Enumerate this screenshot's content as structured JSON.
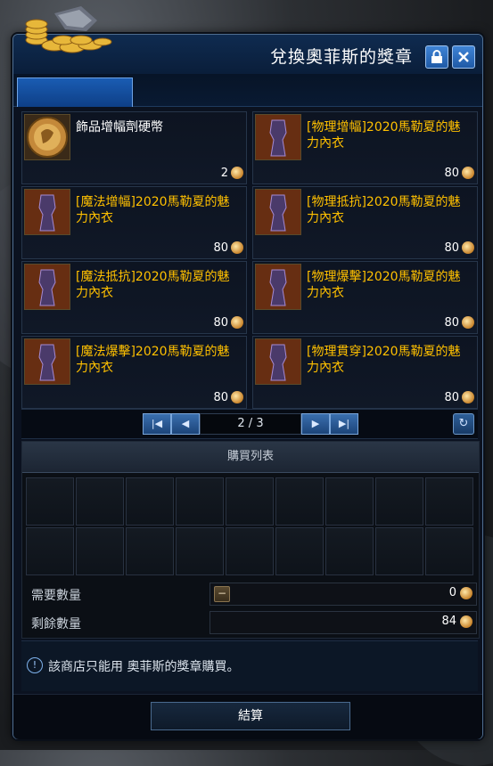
{
  "window": {
    "title": "兌換奧菲斯的獎章",
    "lock_icon": "lock-icon",
    "close_icon": "close-icon"
  },
  "tabs": [
    {
      "label": "",
      "active": true
    }
  ],
  "items": [
    {
      "name": "飾品增幅劑硬幣",
      "price": "2",
      "color": "white",
      "icon": "coin-item-icon"
    },
    {
      "name": "[物理增幅]2020馬勒夏的魅力內衣",
      "price": "80",
      "color": "gold",
      "icon": "costume-icon"
    },
    {
      "name": "[魔法增幅]2020馬勒夏的魅力內衣",
      "price": "80",
      "color": "gold",
      "icon": "costume-icon"
    },
    {
      "name": "[物理抵抗]2020馬勒夏的魅力內衣",
      "price": "80",
      "color": "gold",
      "icon": "costume-icon"
    },
    {
      "name": "[魔法抵抗]2020馬勒夏的魅力內衣",
      "price": "80",
      "color": "gold",
      "icon": "costume-icon"
    },
    {
      "name": "[物理爆擊]2020馬勒夏的魅力內衣",
      "price": "80",
      "color": "gold",
      "icon": "costume-icon"
    },
    {
      "name": "[魔法爆擊]2020馬勒夏的魅力內衣",
      "price": "80",
      "color": "gold",
      "icon": "costume-icon"
    },
    {
      "name": "[物理貫穿]2020馬勒夏的魅力內衣",
      "price": "80",
      "color": "gold",
      "icon": "costume-icon"
    }
  ],
  "pager": {
    "text": "2 / 3",
    "first_label": "|◀",
    "prev_label": "◀",
    "next_label": "▶",
    "last_label": "▶|",
    "refresh_label": "↻"
  },
  "cart": {
    "header": "購買列表",
    "required_label": "需要數量",
    "required_value": "0",
    "minus_label": "−",
    "remaining_label": "剩餘數量",
    "remaining_value": "84"
  },
  "notice": {
    "icon": "!",
    "text": "該商店只能用 奧菲斯的獎章購買。"
  },
  "footer": {
    "checkout_label": "結算"
  },
  "colors": {
    "accent": "#1a5cb3",
    "gold_text": "#ffc000",
    "panel_bg": "#0b1220"
  }
}
